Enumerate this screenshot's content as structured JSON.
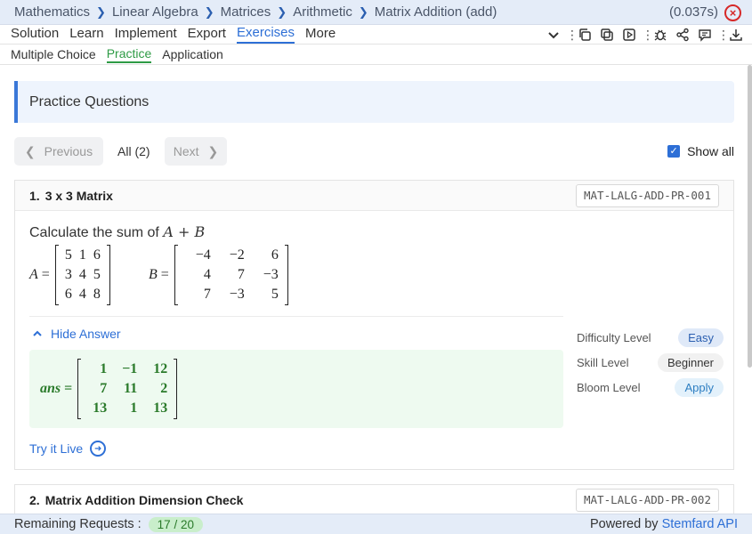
{
  "breadcrumb": [
    "Mathematics",
    "Linear Algebra",
    "Matrices",
    "Arithmetic",
    "Matrix Addition (add)"
  ],
  "timing": "(0.037s)",
  "tabs": [
    "Solution",
    "Learn",
    "Implement",
    "Export",
    "Exercises",
    "More"
  ],
  "active_tab": "Exercises",
  "toolbar_icons": [
    "chevron-down-icon",
    "copy-icon",
    "duplicate-icon",
    "play-icon",
    "bug-icon",
    "share-icon",
    "comment-icon",
    "download-icon"
  ],
  "subtabs": [
    "Multiple Choice",
    "Practice",
    "Application"
  ],
  "active_subtab": "Practice",
  "practice_title": "Practice Questions",
  "nav": {
    "previous": "Previous",
    "all_count": "All (2)",
    "next": "Next",
    "show_all": "Show all"
  },
  "questions": [
    {
      "number": "1.",
      "title": "3 x 3 Matrix",
      "code": "MAT-LALG-ADD-PR-001",
      "prompt": "Calculate the sum of",
      "expr": "A + B",
      "matrix_a": {
        "name": "A",
        "rows": [
          [
            "5",
            "1",
            "6"
          ],
          [
            "3",
            "4",
            "5"
          ],
          [
            "6",
            "4",
            "8"
          ]
        ]
      },
      "matrix_b": {
        "name": "B",
        "rows": [
          [
            "−4",
            "−2",
            "6"
          ],
          [
            "4",
            "7",
            "−3"
          ],
          [
            "7",
            "−3",
            "5"
          ]
        ]
      },
      "hide_answer": "Hide Answer",
      "answer": {
        "name": "ans",
        "rows": [
          [
            "1",
            "−1",
            "12"
          ],
          [
            "7",
            "11",
            "2"
          ],
          [
            "13",
            "1",
            "13"
          ]
        ]
      },
      "try_live": "Try it Live",
      "meta": [
        {
          "label": "Difficulty Level",
          "value": "Easy"
        },
        {
          "label": "Skill Level",
          "value": "Beginner"
        },
        {
          "label": "Bloom Level",
          "value": "Apply"
        }
      ]
    },
    {
      "number": "2.",
      "title": "Matrix Addition Dimension Check",
      "code": "MAT-LALG-ADD-PR-002"
    }
  ],
  "footer": {
    "remaining_label": "Remaining Requests :",
    "remaining_value": "17 / 20",
    "powered_by": "Powered by",
    "brand": "Stemfard API"
  },
  "colors": {
    "accent": "#2d6fd6",
    "practice_green": "#2e9b45",
    "close_red": "#d62828"
  }
}
